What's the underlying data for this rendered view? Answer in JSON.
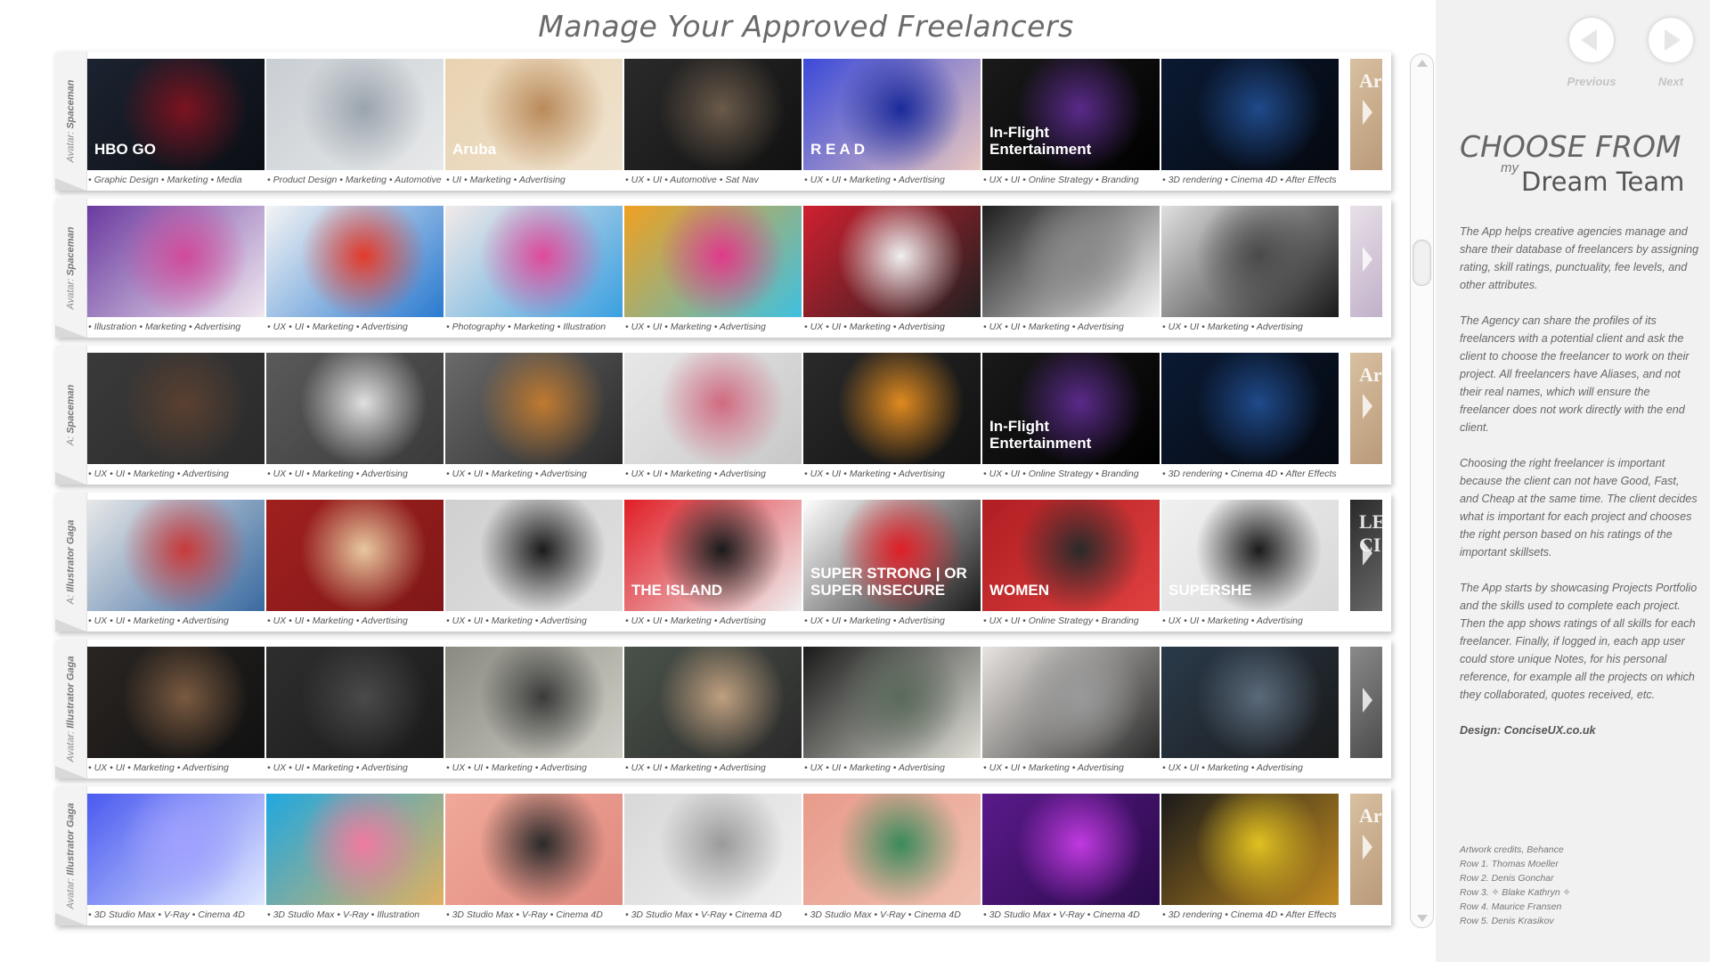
{
  "header": {
    "title": "Manage Your Approved Freelancers"
  },
  "rows": [
    {
      "label_prefix": "Avatar:",
      "label_name": "Spaceman",
      "tiles": [
        {
          "tags": "• Graphic Design • Marketing • Media",
          "caption": "HBO GO",
          "colors": [
            "#1c2330",
            "#7c1320",
            "#0b0e14"
          ]
        },
        {
          "tags": "• Product Design • Marketing • Automotive",
          "caption": "",
          "colors": [
            "#c9ced3",
            "#9aa4ad",
            "#e7e9ea"
          ]
        },
        {
          "tags": "• UI • Marketing • Advertising",
          "caption": "Aruba",
          "colors": [
            "#e8d2b0",
            "#b98a5a",
            "#efe3cf"
          ]
        },
        {
          "tags": "• UX • UI • Automotive • Sat Nav",
          "caption": "",
          "colors": [
            "#2a2a2a",
            "#6a5a4a",
            "#111"
          ]
        },
        {
          "tags": "• UX • UI • Marketing • Advertising",
          "caption": "R E A D",
          "colors": [
            "#3b4ad8",
            "#1b2a9a",
            "#e8c7c0"
          ]
        },
        {
          "tags": "• UX • UI • Online Strategy • Branding",
          "caption": "In-Flight Entertainment",
          "colors": [
            "#1a1a1a",
            "#5a2a8a",
            "#000"
          ]
        },
        {
          "tags": "• 3D rendering • Cinema 4D • After Effects",
          "caption": "",
          "colors": [
            "#0b1a33",
            "#1f4a8a",
            "#05080f"
          ]
        }
      ],
      "peek": {
        "text": "Ar",
        "colors": [
          "#d8c0a0",
          "#b99a7a"
        ]
      }
    },
    {
      "label_prefix": "Avatar:",
      "label_name": "Spaceman",
      "tiles": [
        {
          "tags": "• Illustration • Marketing • Advertising",
          "caption": "",
          "colors": [
            "#6a3aa0",
            "#d04a9a",
            "#f0e8f0"
          ]
        },
        {
          "tags": "• UX • UI • Marketing • Advertising",
          "caption": "",
          "colors": [
            "#f4f4f4",
            "#e33a2a",
            "#2a7ad0"
          ]
        },
        {
          "tags": "• Photography • Marketing • Illustration",
          "caption": "",
          "colors": [
            "#f2eae8",
            "#e04a9a",
            "#3aa0e0"
          ]
        },
        {
          "tags": "• UX • UI • Marketing • Advertising",
          "caption": "",
          "colors": [
            "#f0a020",
            "#e03a8a",
            "#40c0e0"
          ]
        },
        {
          "tags": "• UX • UI • Marketing • Advertising",
          "caption": "",
          "colors": [
            "#d02030",
            "#f0f0f0",
            "#202020"
          ]
        },
        {
          "tags": "• UX • UI • Marketing • Advertising",
          "caption": "",
          "colors": [
            "#1e1e1e",
            "#8a8a8a",
            "#f4f4f4"
          ]
        },
        {
          "tags": "• UX • UI • Marketing • Advertising",
          "caption": "",
          "colors": [
            "#e0e0e0",
            "#4a4a4a",
            "#1a1a1a"
          ]
        }
      ],
      "peek": {
        "text": "",
        "colors": [
          "#e8e0e8",
          "#c0b0c8"
        ]
      }
    },
    {
      "label_prefix": "A:",
      "label_name": "Spaceman",
      "tiles": [
        {
          "tags": "• UX • UI • Marketing • Advertising",
          "caption": "",
          "colors": [
            "#3a3a3a",
            "#5a4030",
            "#2a2a2a"
          ]
        },
        {
          "tags": "• UX • UI • Marketing • Advertising",
          "caption": "",
          "colors": [
            "#5a5a5a",
            "#e0e0e0",
            "#3a3a3a"
          ]
        },
        {
          "tags": "• UX • UI • Marketing • Advertising",
          "caption": "",
          "colors": [
            "#6a6a6a",
            "#c07a30",
            "#2a2a2a"
          ]
        },
        {
          "tags": "• UX • UI • Marketing • Advertising",
          "caption": "",
          "colors": [
            "#e8e8e8",
            "#d06a80",
            "#c8c8c8"
          ]
        },
        {
          "tags": "• UX • UI • Marketing • Advertising",
          "caption": "",
          "colors": [
            "#2a2a2a",
            "#e08a20",
            "#111"
          ]
        },
        {
          "tags": "• UX • UI • Online Strategy • Branding",
          "caption": "In-Flight Entertainment",
          "colors": [
            "#1a1a1a",
            "#5a2a8a",
            "#000"
          ]
        },
        {
          "tags": "• 3D rendering • Cinema 4D • After Effects",
          "caption": "",
          "colors": [
            "#0b1a33",
            "#1f4a8a",
            "#05080f"
          ]
        }
      ],
      "peek": {
        "text": "Ar",
        "colors": [
          "#d8c0a0",
          "#b99a7a"
        ]
      }
    },
    {
      "label_prefix": "A:",
      "label_name": "Illustrator Gaga",
      "tiles": [
        {
          "tags": "• UX • UI • Marketing • Advertising",
          "caption": "",
          "colors": [
            "#e8e8e8",
            "#c83a3a",
            "#3a6aa0"
          ]
        },
        {
          "tags": "• UX • UI • Marketing • Advertising",
          "caption": "",
          "colors": [
            "#a0201e",
            "#e8c8a0",
            "#801818"
          ]
        },
        {
          "tags": "• UX • UI • Marketing • Advertising",
          "caption": "",
          "colors": [
            "#d0d0d0",
            "#1a1a1a",
            "#e0e0e0"
          ]
        },
        {
          "tags": "• UX • UI • Marketing • Advertising",
          "caption": "THE ISLAND",
          "colors": [
            "#e01e26",
            "#1a1a1a",
            "#f0f0f0"
          ]
        },
        {
          "tags": "• UX • UI • Marketing • Advertising",
          "caption": "SUPER STRONG | OR SUPER INSECURE",
          "colors": [
            "#ffffff",
            "#e01e26",
            "#1a1a1a"
          ]
        },
        {
          "tags": "• UX • UI • Online Strategy • Branding",
          "caption": "WOMEN",
          "colors": [
            "#b01e22",
            "#2a2a2a",
            "#e04040"
          ]
        },
        {
          "tags": "• UX • UI • Marketing • Advertising",
          "caption": "SUPERSHE",
          "colors": [
            "#f0f0f0",
            "#1a1a1a",
            "#d8d8d8"
          ]
        }
      ],
      "peek": {
        "text": "LE CI",
        "colors": [
          "#2a2a2a",
          "#6a6a6a"
        ]
      }
    },
    {
      "label_prefix": "Avatar:",
      "label_name": "Illustrator Gaga",
      "tiles": [
        {
          "tags": "• UX • UI • Marketing • Advertising",
          "caption": "",
          "colors": [
            "#2a2522",
            "#7a5a40",
            "#111"
          ]
        },
        {
          "tags": "• UX • UI • Marketing • Advertising",
          "caption": "",
          "colors": [
            "#2e2e2e",
            "#4a4a4a",
            "#1a1a1a"
          ]
        },
        {
          "tags": "• UX • UI • Marketing • Advertising",
          "caption": "",
          "colors": [
            "#8a8a80",
            "#3a3a3a",
            "#d0d0c8"
          ]
        },
        {
          "tags": "• UX • UI • Marketing • Advertising",
          "caption": "",
          "colors": [
            "#4a524a",
            "#c0a080",
            "#2a2a2a"
          ]
        },
        {
          "tags": "• UX • UI • Marketing • Advertising",
          "caption": "",
          "colors": [
            "#1a1a1a",
            "#5a6a5a",
            "#e0e0d8"
          ]
        },
        {
          "tags": "• UX • UI • Marketing • Advertising",
          "caption": "",
          "colors": [
            "#e8e4e0",
            "#9a9a9a",
            "#2a2a2a"
          ]
        },
        {
          "tags": "• UX • UI • Marketing • Advertising",
          "caption": "",
          "colors": [
            "#2a3a4a",
            "#5a6a7a",
            "#1a1a1a"
          ]
        }
      ],
      "peek": {
        "text": "",
        "colors": [
          "#8a8a8a",
          "#4a4a4a"
        ]
      }
    },
    {
      "label_prefix": "Avatar:",
      "label_name": "Illustrator Gaga",
      "tiles": [
        {
          "tags": "• 3D Studio Max • V-Ray • Cinema 4D",
          "caption": "",
          "colors": [
            "#4a5af0",
            "#a0a0ff",
            "#e0e8ff"
          ]
        },
        {
          "tags": "• 3D Studio Max • V-Ray • Illustration",
          "caption": "",
          "colors": [
            "#20a8e0",
            "#f07aa0",
            "#e0b060"
          ]
        },
        {
          "tags": "• 3D Studio Max • V-Ray • Cinema 4D",
          "caption": "",
          "colors": [
            "#f0a898",
            "#2a2a2a",
            "#e08a80"
          ]
        },
        {
          "tags": "• 3D Studio Max • V-Ray • Cinema 4D",
          "caption": "",
          "colors": [
            "#d8d8d8",
            "#9a9a9a",
            "#f0f0f0"
          ]
        },
        {
          "tags": "• 3D Studio Max • V-Ray • Cinema 4D",
          "caption": "",
          "colors": [
            "#e89a8a",
            "#3a8a5a",
            "#f0c0b0"
          ]
        },
        {
          "tags": "• 3D Studio Max • V-Ray • Cinema 4D",
          "caption": "",
          "colors": [
            "#5a1a8a",
            "#c03ae0",
            "#2a0a4a"
          ]
        },
        {
          "tags": "• 3D rendering • Cinema 4D • After Effects",
          "caption": "",
          "colors": [
            "#1a1a1a",
            "#e0c020",
            "#c08a20"
          ]
        }
      ],
      "peek": {
        "text": "Ar",
        "colors": [
          "#d8c0a0",
          "#b99a7a"
        ]
      }
    }
  ],
  "nav": {
    "previous_label": "Previous",
    "next_label": "Next"
  },
  "panel": {
    "heading_line1": "CHOOSE FROM",
    "heading_my": "my",
    "heading_line2": "Dream Team",
    "para1": "The App helps creative agencies manage and share their database of freelancers by assigning rating, skill ratings, punctuality, fee levels, and other attributes.",
    "para2": "The Agency can share the profiles of its freelancers with a potential client and ask the client to choose the freelancer to work on their project. All freelancers have Aliases, and not their real names, which will ensure the freelancer does not work directly with the end client.",
    "para3": "Choosing the right freelancer is important because the client can not have Good, Fast, and Cheap at the same time. The client decides what is important for each project and chooses the right person based on his ratings of the important skillsets.",
    "para4": "The App starts by showcasing Projects Portfolio and the skills used to complete each project. Then the app shows ratings of all skills for each freelancer. Finally, if logged in, each app user could store unique Notes, for his personal reference, for example all the projects on which they collaborated, quotes received, etc.",
    "design": "Design: ConciseUX.co.uk"
  },
  "credits": [
    "Artwork credits, Behance",
    "Row 1. Thomas Moeller",
    "Row 2. Denis Gonchar",
    "Row 3. ✧ Blake Kathryn ✧",
    "Row 4. Maurice Fransen",
    "Row 5. Denis Krasikov"
  ]
}
